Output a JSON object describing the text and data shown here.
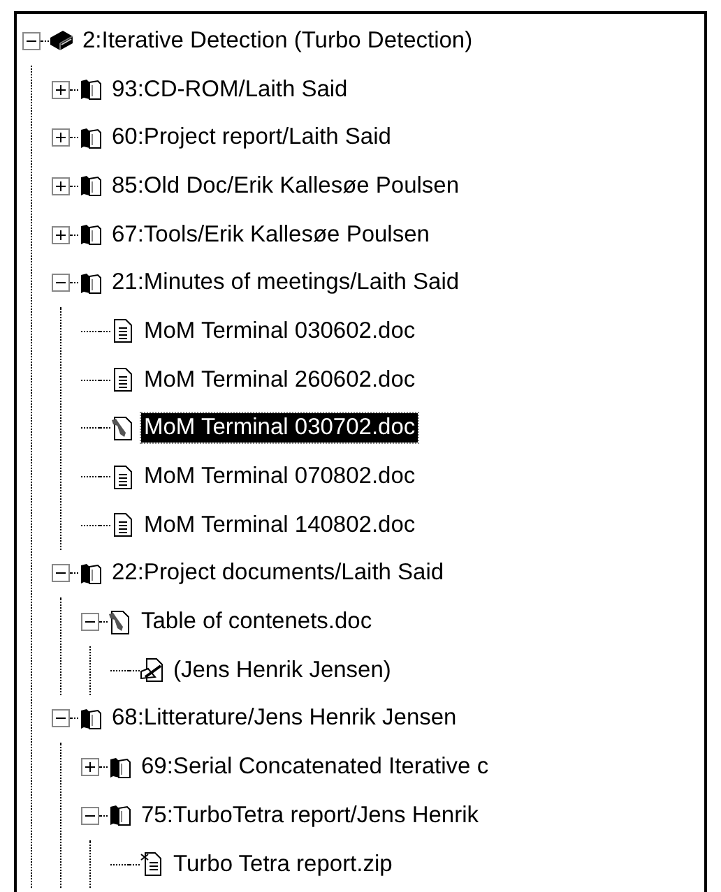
{
  "tree": [
    {
      "label": "2:Iterative Detection (Turbo Detection)",
      "kind": "book",
      "expanded": true,
      "selected": false,
      "children": [
        {
          "label": "93:CD-ROM/Laith Said",
          "kind": "open-book",
          "expanded": false,
          "selected": false
        },
        {
          "label": "60:Project report/Laith Said",
          "kind": "open-book",
          "expanded": false,
          "selected": false
        },
        {
          "label": "85:Old Doc/Erik Kallesøe Poulsen",
          "kind": "open-book",
          "expanded": false,
          "selected": false
        },
        {
          "label": "67:Tools/Erik Kallesøe Poulsen",
          "kind": "open-book",
          "expanded": false,
          "selected": false
        },
        {
          "label": "21:Minutes of meetings/Laith Said",
          "kind": "open-book",
          "expanded": true,
          "selected": false,
          "children": [
            {
              "label": "MoM Terminal 030602.doc",
              "kind": "document",
              "selected": false
            },
            {
              "label": "MoM Terminal 260602.doc",
              "kind": "document",
              "selected": false
            },
            {
              "label": "MoM Terminal 030702.doc",
              "kind": "tool-document",
              "selected": true
            },
            {
              "label": "MoM Terminal 070802.doc",
              "kind": "document",
              "selected": false
            },
            {
              "label": "MoM Terminal 140802.doc",
              "kind": "document",
              "selected": false
            }
          ]
        },
        {
          "label": "22:Project documents/Laith Said",
          "kind": "open-book",
          "expanded": true,
          "selected": false,
          "children": [
            {
              "label": "Table of contenets.doc",
              "kind": "tool-document",
              "expanded": true,
              "selected": false,
              "children": [
                {
                  "label": "(Jens Henrik Jensen)",
                  "kind": "signed-document",
                  "selected": false
                }
              ]
            }
          ]
        },
        {
          "label": "68:Litterature/Jens Henrik Jensen",
          "kind": "open-book",
          "expanded": true,
          "selected": false,
          "children": [
            {
              "label": "69:Serial Concatenated Iterative c",
              "kind": "open-book",
              "expanded": false,
              "selected": false
            },
            {
              "label": "75:TurboTetra report/Jens Henrik",
              "kind": "open-book",
              "expanded": true,
              "selected": false,
              "children": [
                {
                  "label": "Turbo Tetra report.zip",
                  "kind": "zip-document",
                  "selected": false
                }
              ]
            }
          ]
        }
      ]
    }
  ]
}
